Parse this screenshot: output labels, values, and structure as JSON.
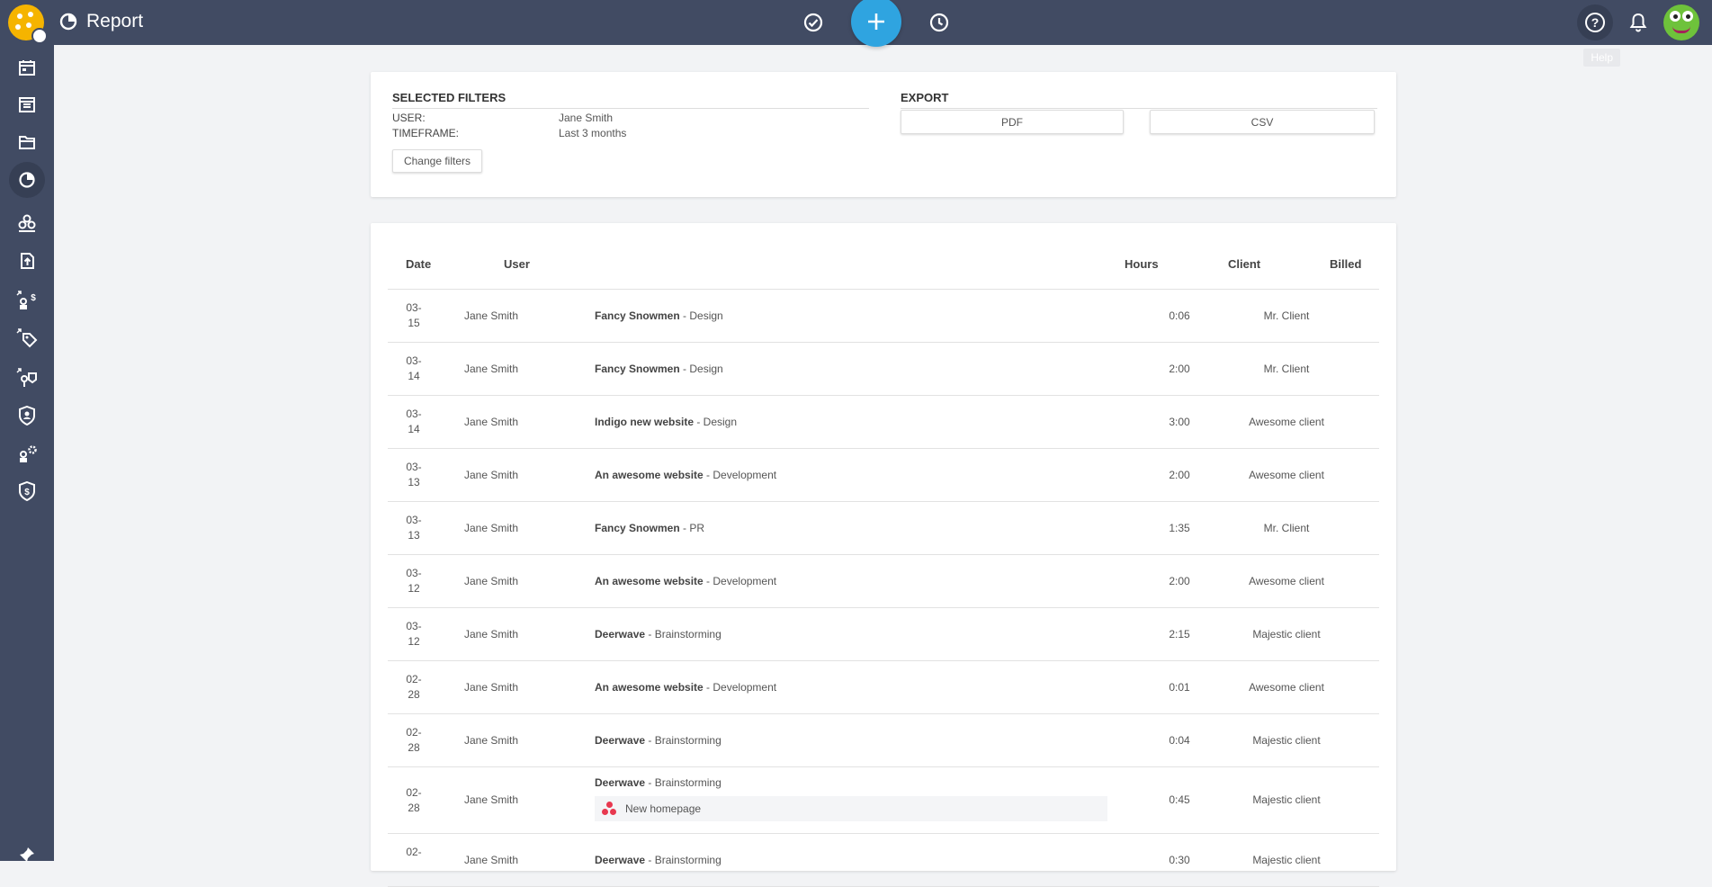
{
  "header": {
    "title": "Report",
    "tooltip": "Help"
  },
  "sidebar": {
    "items": [
      "calendar-icon",
      "board-icon",
      "folder-icon",
      "report-pie-icon",
      "team-icon",
      "upload-icon",
      "billing-users-icon",
      "tags-icon",
      "integrations-icon",
      "security-icon",
      "settings-users-icon",
      "billing-shield-icon"
    ],
    "active": "report-pie-icon"
  },
  "filters": {
    "section_title": "SELECTED FILTERS",
    "user_label": "USER:",
    "user_value": "Jane Smith",
    "timeframe_label": "TIMEFRAME:",
    "timeframe_value": "Last 3 months",
    "change_button": "Change filters"
  },
  "export": {
    "section_title": "EXPORT",
    "pdf_label": "PDF",
    "csv_label": "CSV"
  },
  "table": {
    "headers": {
      "date": "Date",
      "user": "User",
      "hours": "Hours",
      "client": "Client",
      "billed": "Billed"
    },
    "rows": [
      {
        "date_a": "03-",
        "date_b": "15",
        "user": "Jane Smith",
        "project": "Fancy Snowmen",
        "task": " - Design",
        "hours": "0:06",
        "client": "Mr. Client"
      },
      {
        "date_a": "03-",
        "date_b": "14",
        "user": "Jane Smith",
        "project": "Fancy Snowmen",
        "task": " - Design",
        "hours": "2:00",
        "client": "Mr. Client"
      },
      {
        "date_a": "03-",
        "date_b": "14",
        "user": "Jane Smith",
        "project": "Indigo new website",
        "task": " - Design",
        "hours": "3:00",
        "client": "Awesome client"
      },
      {
        "date_a": "03-",
        "date_b": "13",
        "user": "Jane Smith",
        "project": "An awesome website",
        "task": " - Development",
        "hours": "2:00",
        "client": "Awesome client"
      },
      {
        "date_a": "03-",
        "date_b": "13",
        "user": "Jane Smith",
        "project": "Fancy Snowmen",
        "task": " - PR",
        "hours": "1:35",
        "client": "Mr. Client"
      },
      {
        "date_a": "03-",
        "date_b": "12",
        "user": "Jane Smith",
        "project": "An awesome website",
        "task": " - Development",
        "hours": "2:00",
        "client": "Awesome client"
      },
      {
        "date_a": "03-",
        "date_b": "12",
        "user": "Jane Smith",
        "project": "Deerwave",
        "task": " - Brainstorming",
        "hours": "2:15",
        "client": "Majestic client"
      },
      {
        "date_a": "02-",
        "date_b": "28",
        "user": "Jane Smith",
        "project": "An awesome website",
        "task": " - Development",
        "hours": "0:01",
        "client": "Awesome client"
      },
      {
        "date_a": "02-",
        "date_b": "28",
        "user": "Jane Smith",
        "project": "Deerwave",
        "task": " - Brainstorming",
        "hours": "0:04",
        "client": "Majestic client"
      },
      {
        "date_a": "02-",
        "date_b": "28",
        "user": "Jane Smith",
        "project": "Deerwave",
        "task": " - Brainstorming",
        "hours": "0:45",
        "client": "Majestic client",
        "linked_task": "New homepage"
      },
      {
        "date_a": "02-",
        "date_b": "",
        "user": "Jane Smith",
        "project": "Deerwave",
        "task": " - Brainstorming",
        "hours": "0:30",
        "client": "Majestic client"
      }
    ]
  }
}
